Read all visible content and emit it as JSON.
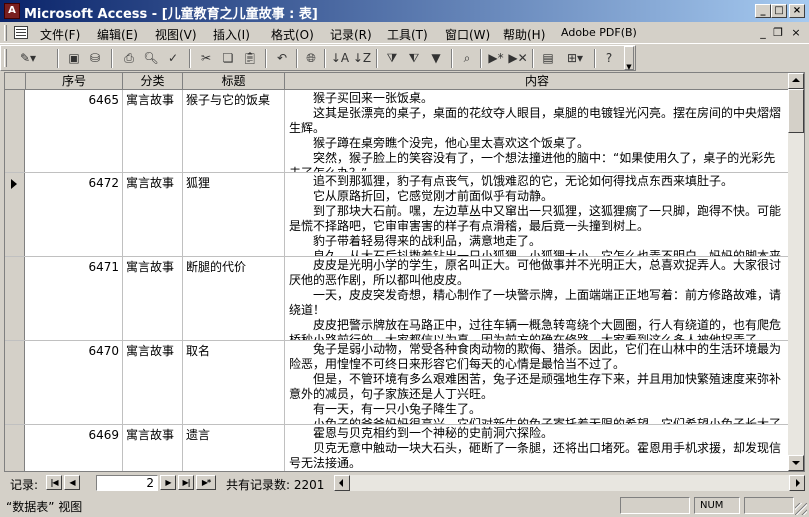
{
  "window": {
    "title": "Microsoft Access - [儿童教育之儿童故事 : 表]",
    "app_icon": "A"
  },
  "menu": {
    "items": [
      "文件(F)",
      "编辑(E)",
      "视图(V)",
      "插入(I)",
      "格式(O)",
      "记录(R)",
      "工具(T)",
      "窗口(W)",
      "帮助(H)",
      "Adobe PDF(B)"
    ]
  },
  "toolbar": {
    "icons": [
      "view-icon",
      "save-icon",
      "print-icon",
      "print-preview-icon",
      "spelling-icon",
      "cut-icon",
      "copy-icon",
      "paste-icon",
      "undo-icon",
      "hyperlink-icon",
      "sort-ascending-icon",
      "sort-descending-icon",
      "filter-by-selection-icon",
      "filter-by-form-icon",
      "apply-filter-icon",
      "find-icon",
      "new-record-icon",
      "delete-record-icon",
      "database-window-icon",
      "new-object-icon",
      "help-icon"
    ]
  },
  "table": {
    "columns": [
      "序号",
      "分类",
      "标题",
      "内容"
    ],
    "rows": [
      {
        "id": "6465",
        "category": "寓言故事",
        "title": "猴子与它的饭桌",
        "current": false,
        "content": [
          "猴子买回来一张饭桌。",
          "这其是张漂亮的桌子，桌面的花纹夺人眼目，桌腿的电镀锃光闪亮。摆在房间的中央熠熠生辉。",
          "猴子蹲在桌旁瞧个没完，他心里太喜欢这个饭桌了。",
          "突然，猴子脸上的笑容没有了，一个想法撞进他的脑中：“如果使用久了，桌子的光彩先夫了怎么办？”"
        ]
      },
      {
        "id": "6472",
        "category": "寓言故事",
        "title": "狐狸",
        "current": true,
        "content": [
          "追不到那狐狸，豹子有点丧气，饥饿难忍的它，无论如何得找点东西来填肚子。",
          "它从原路折回，它感觉刚才前面似乎有动静。",
          "到了那块大石前。嘿，左边草丛中又窜出一只狐狸，这狐狸瘸了一只脚，跑得不快。可能是慌不择路吧，它审审害害的样子有点滑稽，最后竟一头撞到树上。",
          "豹子带着轻易得来的战利品，满意地走了。",
          "良久，从大石后抖擞着钻出一只小狐狸，小狐狸太小，它怎么也弄不明白，妈妈的脚本来"
        ]
      },
      {
        "id": "6471",
        "category": "寓言故事",
        "title": "断腿的代价",
        "current": false,
        "content": [
          "皮皮是光明小学的学生，原名叫正大。可他做事并不光明正大，总喜欢捉弄人。大家很讨厌他的恶作剧，所以都叫他皮皮。",
          "一天，皮皮突发奇想，精心制作了一块警示牌，上面端端正正地写着：前方修路故难，请绕道！",
          "皮皮把警示牌放在马路正中，过往车辆一概急转弯绕个大圆圈，行人有绕道的，也有爬危桥秒小路前行的。大家都信以为真，因为前方的确在修路。大家看到这么多人被他捉弄了，"
        ]
      },
      {
        "id": "6470",
        "category": "寓言故事",
        "title": "取名",
        "current": false,
        "content": [
          "兔子是弱小动物，常受各种食肉动物的欺侮、猎杀。因此，它们在山林中的生活环境最为险恶，用惶惶不可终日来形容它们每天的心情是最恰当不过了。",
          "但是，不管环境有多么艰难困苦，兔子还是顽强地生存下来，并且用加快繁殖速度来弥补意外的减员，句子家族还是人丁兴旺。",
          "有一天，有一只小兔子降生了。",
          "小兔子的爸爸妈妈很高兴，它们对新生的兔子寄托着无限的希望。它们希望小兔子长大了"
        ]
      },
      {
        "id": "6469",
        "category": "寓言故事",
        "title": "遗言",
        "current": false,
        "content": [
          "霍恩与贝克相约到一个神秘的史前洞穴探险。",
          "贝克无意中触动一块大石头，砸断了一条腿，还将出口堵死。霍恩用手机求援，却发现信号无法接通。",
          "岁月一天天过去，贝克因失血过多而昏迷。又一天过去了，"
        ]
      }
    ]
  },
  "navigation": {
    "label": "记录:",
    "current_record": "2",
    "total_text": "共有记录数: 2201",
    "buttons": [
      "|◀",
      "◀",
      "▶",
      "▶|",
      "▶*"
    ]
  },
  "status": {
    "view_text": "“数据表” 视图",
    "num_indicator": "NUM"
  }
}
